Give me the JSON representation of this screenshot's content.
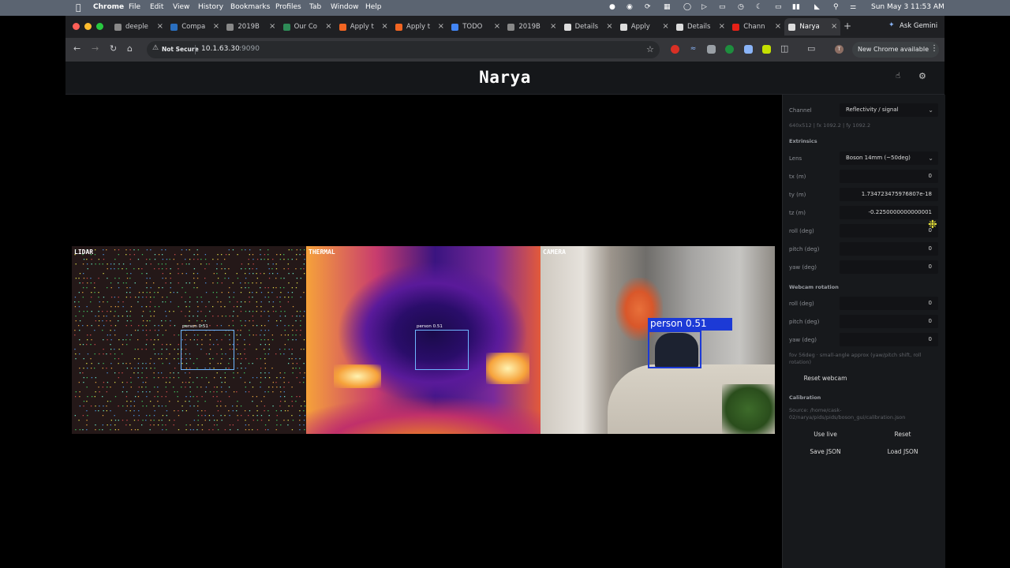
{
  "menubar": {
    "app": "Chrome",
    "items": [
      "File",
      "Edit",
      "View",
      "History",
      "Bookmarks",
      "Profiles",
      "Tab",
      "Window",
      "Help"
    ],
    "clock": "Sun May 3  11:53 AM"
  },
  "tabs": [
    {
      "label": "deeple",
      "color": "#888"
    },
    {
      "label": "Compa",
      "color": "#2a6fbf"
    },
    {
      "label": "2019B",
      "color": "#888"
    },
    {
      "label": "Our Co",
      "color": "#2e8b57"
    },
    {
      "label": "Apply t",
      "color": "#f26522"
    },
    {
      "label": "Apply t",
      "color": "#f26522"
    },
    {
      "label": "TODO",
      "color": "#4285f4"
    },
    {
      "label": "2019B",
      "color": "#888"
    },
    {
      "label": "Details",
      "color": "#ddd"
    },
    {
      "label": "Apply",
      "color": "#ddd"
    },
    {
      "label": "Details",
      "color": "#ddd"
    },
    {
      "label": "Chann",
      "color": "#e62117"
    },
    {
      "label": "Narya",
      "color": "#ddd",
      "active": true
    }
  ],
  "toolbar": {
    "ask_gemini": "Ask Gemini",
    "security": "Not Secure",
    "url_host": "10.1.63.30",
    "url_port": ":9090",
    "update_button": "New Chrome available"
  },
  "app": {
    "title": "Narya"
  },
  "feeds": {
    "lidar": {
      "label": "LIDAR",
      "detection": "person 0.51"
    },
    "thermal": {
      "label": "THERMAL",
      "detection": "person 0.51"
    },
    "camera": {
      "label": "CAMERA",
      "detection": "person 0.51"
    }
  },
  "panel": {
    "channel_label": "Channel",
    "channel_value": "Reflectivity / signal",
    "intrinsics": "640x512 | fx 1092.2 | fy 1092.2",
    "extrinsics_title": "Extrinsics",
    "lens_label": "Lens",
    "lens_value": "Boson 14mm (~50deg)",
    "fields": [
      {
        "label": "tx (m)",
        "value": "0"
      },
      {
        "label": "ty (m)",
        "value": "1.734723475976807e-18"
      },
      {
        "label": "tz (m)",
        "value": "-0.2250000000000001"
      },
      {
        "label": "roll (deg)",
        "value": "0"
      },
      {
        "label": "pitch (deg)",
        "value": "0"
      },
      {
        "label": "yaw (deg)",
        "value": "0"
      }
    ],
    "webcam_title": "Webcam rotation",
    "webcam_fields": [
      {
        "label": "roll (deg)",
        "value": "0"
      },
      {
        "label": "pitch (deg)",
        "value": "0"
      },
      {
        "label": "yaw (deg)",
        "value": "0"
      }
    ],
    "webcam_note": "fov 56deg · small-angle approx (yaw/pitch shift, roll rotation)",
    "reset_webcam": "Reset webcam",
    "calibration_title": "Calibration",
    "calibration_source": "Source: /home/cask-02/narya/pids/pids/boson_gui/calibration.json",
    "use_live": "Use live",
    "reset": "Reset",
    "save_json": "Save JSON",
    "load_json": "Load JSON"
  }
}
